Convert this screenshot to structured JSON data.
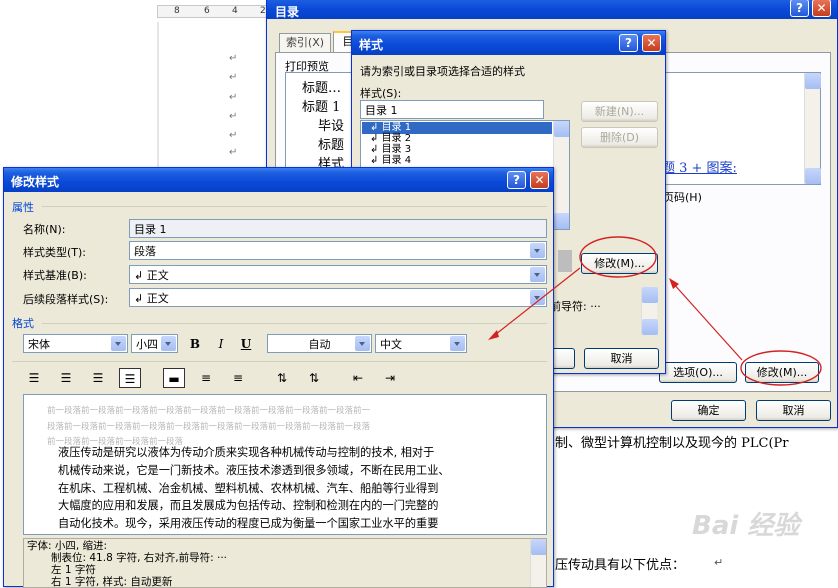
{
  "document": {
    "ruler_ticks": [
      "8",
      "6",
      "4",
      "2"
    ],
    "paragraph_mark": "↵",
    "text_fragment_1": "制、微型计算机控制以及现今的 PLC(Pr",
    "text_fragment_2": "压传动具有以下优点：",
    "watermark": "Bai 经验"
  },
  "toc_dialog": {
    "title": "目录",
    "help_label": "?",
    "close_label": "✕",
    "tabs": [
      "索引(X)",
      "目"
    ],
    "print_preview_label": "打印预览",
    "preview_lines": [
      "标题…",
      "标题 1",
      "毕设",
      "标题",
      "样式"
    ],
    "web_link_text": "题 3 + 图案:",
    "page_number_label": "页码(H)",
    "options_button": "选项(O)...",
    "modify_button": "修改(M)...",
    "ok_button": "确定",
    "cancel_button": "取消"
  },
  "style_dialog": {
    "title": "样式",
    "instruction": "请为索引或目录项选择合适的样式",
    "styles_label": "样式(S):",
    "style_input": "目录 1",
    "list_items": [
      "目录 1",
      "目录 2",
      "目录 3",
      "目录 4"
    ],
    "new_button": "新建(N)...",
    "delete_button": "删除(D)",
    "modify_button": "修改(M)...",
    "leader_text": "前导符: ···",
    "cancel_button": "取消"
  },
  "modify_dialog": {
    "title": "修改样式",
    "section_properties": "属性",
    "name_label": "名称(N):",
    "name_value": "目录 1",
    "type_label": "样式类型(T):",
    "type_value": "段落",
    "based_label": "样式基准(B):",
    "based_value": "正文",
    "next_label": "后续段落样式(S):",
    "next_value": "正文",
    "section_format": "格式",
    "font_value": "宋体",
    "size_value": "小四",
    "bold": "B",
    "italic": "I",
    "underline": "U",
    "color_value": "自动",
    "lang_value": "中文",
    "preview_gray": [
      "前一段落前一段落前一段落前一段落前一段落前一段落前一段落前一段落前一段落前一",
      "段落前一段落前一段落前一段落前一段落前一段落前一段落前一段落前一段落前一段落",
      "前一段落前一段落前一段落前一段落"
    ],
    "preview_text": [
      "液压传动是研究以液体为传动介质来实现各种机械传动与控制的技术, 相对于",
      "机械传动来说，它是一门新技术。液压技术渗透到很多领域，不断在民用工业、",
      "在机床、工程机械、冶金机械、塑料机械、农林机械、汽车、船舶等行业得到",
      "大幅度的应用和发展，而且发展成为包括传动、控制和检测在内的一门完整的",
      "自动化技术。现今，采用液压传动的程度已成为衡量一个国家工业水平的重要"
    ],
    "description": [
      "字体: 小四, 缩进:",
      "制表位:  41.8 字符, 右对齐,前导符: ···",
      "左  1 字符",
      "右  1 字符, 样式: 自动更新"
    ]
  },
  "colors": {
    "titlebar": "#0a49d8",
    "dialog_bg": "#ece9d8",
    "annotation": "#d42020",
    "group_label": "#0046d5"
  }
}
